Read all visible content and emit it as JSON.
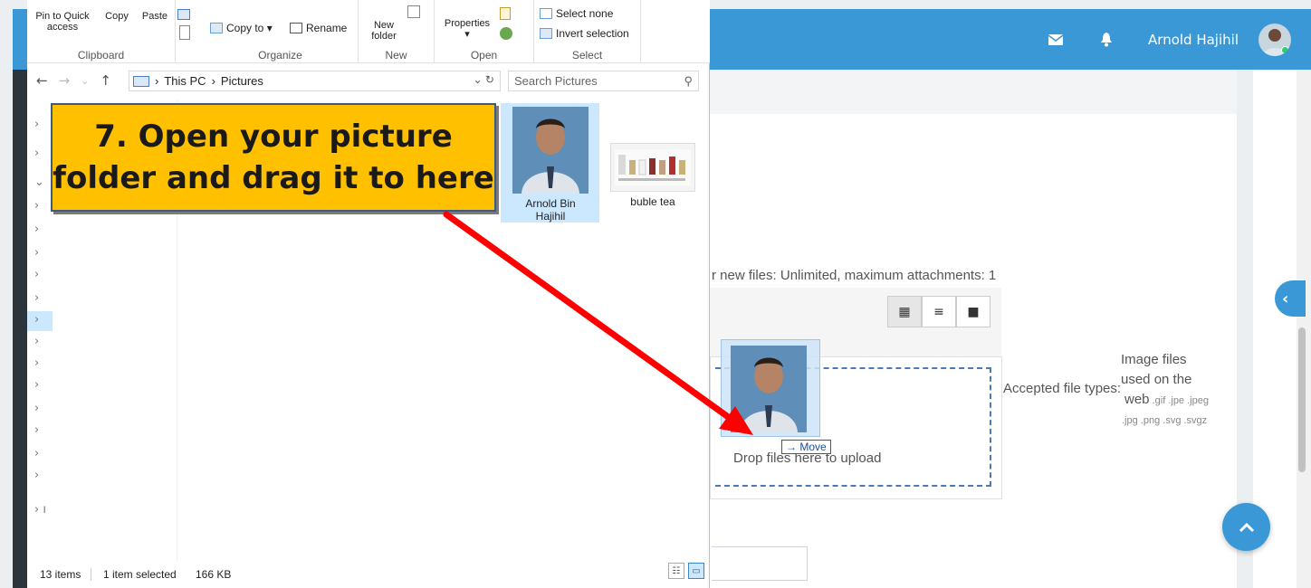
{
  "topbar": {
    "user_name": "Arnold Hajihil",
    "mail_icon": "envelope-icon",
    "bell_icon": "bell-icon",
    "accent": "#3a98d6"
  },
  "explorer": {
    "ribbon": {
      "clipboard": {
        "group_label": "Clipboard",
        "pin_label_1": "Pin to Quick",
        "pin_label_2": "access",
        "copy_label": "Copy",
        "paste_label": "Paste"
      },
      "organize": {
        "group_label": "Organize",
        "copy_to_label": "Copy to ▾",
        "rename_label": "Rename"
      },
      "new": {
        "group_label": "New",
        "new_folder_1": "New",
        "new_folder_2": "folder"
      },
      "open": {
        "group_label": "Open",
        "properties_label": "Properties",
        "properties_arrow": "▾"
      },
      "select": {
        "group_label": "Select",
        "select_none_label": "Select none",
        "invert_selection_label": "Invert selection"
      }
    },
    "address": {
      "crumb_1": "This PC",
      "crumb_2": "Pictures",
      "separator": "›"
    },
    "search": {
      "placeholder": "Search Pictures"
    },
    "files": [
      {
        "name_1": "Arnold Bin",
        "name_2": "Hajihil",
        "selected": true
      },
      {
        "name_1": "buble tea",
        "name_2": "",
        "selected": false
      }
    ],
    "status": {
      "item_count": "13 items",
      "selection": "1 item selected",
      "size": "166 KB"
    }
  },
  "callout": {
    "line_1": "7. Open your picture",
    "line_2": "folder and drag it to here",
    "color": "#ffc000"
  },
  "filepicker": {
    "info": "r new files: Unlimited, maximum attachments: 1",
    "drop_text": "Drop files here to upload",
    "move_tip": "→ Move",
    "accepted_label": "Accepted file types:",
    "accepted_line_1": "Image files",
    "accepted_line_2": "used on the",
    "accepted_line_3a": "web",
    "accepted_line_3b": " .gif .jpe .jpeg",
    "accepted_line_4": ".jpg .png .svg .svgz"
  },
  "arrow_color": "#ff0000"
}
